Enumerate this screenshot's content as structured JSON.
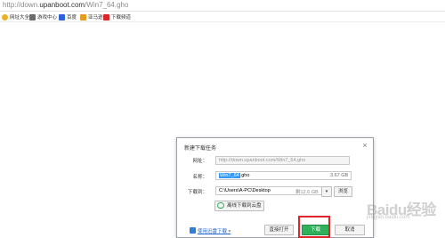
{
  "browser": {
    "url_scheme": "http://down.",
    "url_host": "upanboot.com",
    "url_path": "/Win7_64.gho",
    "favorites": [
      {
        "label": "网址大全",
        "icon": "globe-icon",
        "color": "#e9b22a"
      },
      {
        "label": "游戏中心",
        "icon": "gamepad-icon",
        "color": "#6a6a6a"
      },
      {
        "label": "百度",
        "icon": "baidu-icon",
        "color": "#2d62d8"
      },
      {
        "label": "亚马逊",
        "icon": "amazon-icon",
        "color": "#e69b1f"
      },
      {
        "label": "下载频道",
        "icon": "download-channel-icon",
        "color": "#d9262b"
      }
    ]
  },
  "dialog": {
    "title": "新建下载任务",
    "url_label": "网址：",
    "url_value": "http://down.upanboot.com/Win7_64.gho",
    "name_label": "名称：",
    "name_selected": "Win7_64",
    "name_rest": ".gho",
    "file_size": "3.67 GB",
    "path_label": "下载到：",
    "path_value": "C:\\Users\\A-PC\\Desktop",
    "free_space": "剩12.6 GB",
    "browse_label": "浏览",
    "offline_label": "离线下载到云盘",
    "speedup_label": "使用迅雷下载",
    "open_label": "直接打开",
    "download_label": "下载",
    "cancel_label": "取消"
  },
  "watermark": {
    "main": "Baidu经验",
    "sub": "jingyan.baidu.com"
  },
  "colors": {
    "primary_button": "#2fb05a",
    "highlight_box": "#e0242c",
    "selection": "#3399ff"
  }
}
